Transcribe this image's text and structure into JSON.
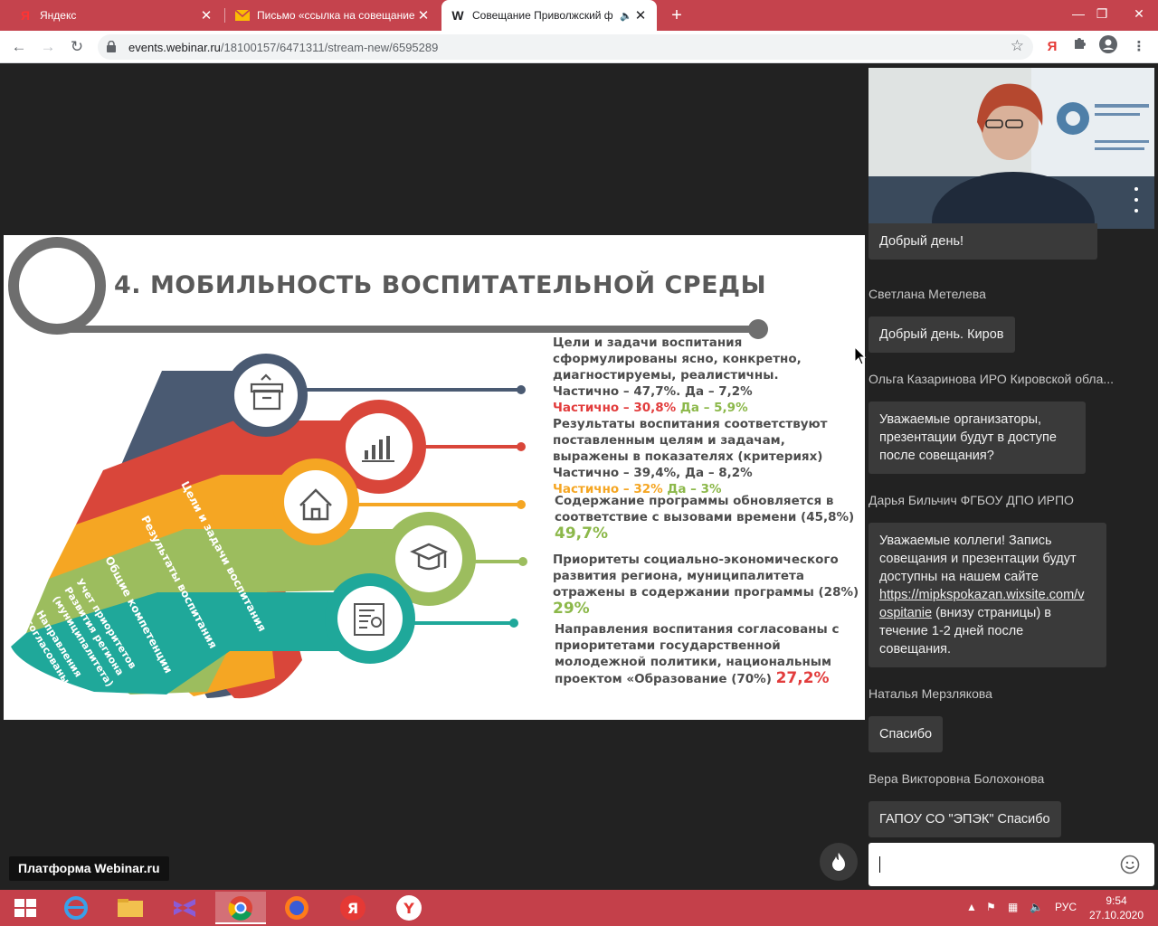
{
  "browser": {
    "tabs": [
      {
        "favicon": "Я",
        "title": "Яндекс"
      },
      {
        "favicon": "envelope",
        "title": "Письмо «ссылка на совещание"
      },
      {
        "favicon": "W",
        "title": "Совещание Приволжский ф"
      }
    ],
    "url_host": "events.webinar.ru",
    "url_path": "/18100157/6471311/stream-new/6595289",
    "yandex_ext": "Я"
  },
  "slide": {
    "title": "4. МОБИЛЬНОСТЬ ВОСПИТАТЕЛЬНОЙ СРЕДЫ",
    "ribbons": [
      "Цели и задачи воспитания",
      "Результаты воспитания",
      "Общие компетенции",
      "Учет приоритетов",
      "Развития региона",
      "(муниципалитета)",
      "Направления",
      "согласованы"
    ],
    "blocks": [
      {
        "lines": [
          "Цели и задачи воспитания",
          "сформулированы ясно, конкретно,",
          "диагностируемы, реалистичны.",
          "Частично – 47,7%. Да – 7,2%"
        ],
        "colored_a": "Частично – 30,8%",
        "colored_b": "Да – 5,9%"
      },
      {
        "lines": [
          "Результаты воспитания соответствуют",
          "поставленным целям и задачам,",
          "выражены в показателях (критериях)",
          "Частично – 39,4%, Да – 8,2%"
        ],
        "colored_a": "Частично – 32%",
        "colored_b": "Да – 3%"
      },
      {
        "lines": [
          "Содержание программы обновляется в",
          "соответствие с вызовами времени (45,8%)"
        ],
        "big": "49,7%"
      },
      {
        "lines": [
          "Приоритеты социально-экономического",
          "развития региона, муниципалитета",
          "отражены в содержании программы (28%)"
        ],
        "big": "29%"
      },
      {
        "lines": [
          "Направления воспитания согласованы с",
          "приоритетами государственной",
          "молодежной политики, национальным"
        ],
        "last_line": "проектом «Образование (70%)",
        "big": "27,2%"
      }
    ]
  },
  "chat": {
    "messages": [
      {
        "author": "",
        "text": "Добрый день!"
      },
      {
        "author": "Светлана Метелева",
        "text": "Добрый день. Киров"
      },
      {
        "author": "Ольга Казаринова ИРО Кировской обла...",
        "text_lines": [
          "Уважаемые организаторы,",
          "презентации будут в доступе",
          "после совещания?"
        ]
      },
      {
        "author": "Дарья Бильчич ФГБОУ ДПО ИРПО",
        "text_lines": [
          "Уважаемые коллеги! Запись",
          "совещания и презентации будут",
          "доступны на нашем сайте"
        ],
        "link_1": "https://mipkspokazan.wixsite.com/v",
        "link_2": "ospitanie",
        "after_link": " (внизу страницы) в",
        "tail_lines": [
          "течение 1-2 дней после",
          "совещания."
        ]
      },
      {
        "author": "Наталья Мерзлякова",
        "text": "Спасибо"
      },
      {
        "author": "Вера Викторовна Болохонова",
        "text": "ГАПОУ СО \"ЭПЭК\" Спасибо"
      }
    ],
    "input_placeholder": ""
  },
  "brand_badge": "Платформа Webinar.ru",
  "taskbar": {
    "lang": "РУС",
    "time": "9:54",
    "date": "27.10.2020"
  },
  "colors": {
    "tabstrip": "#c5434d",
    "taskbar": "#c4404a",
    "ribbon_navy": "#4a5a72",
    "ribbon_red": "#d9463a",
    "ribbon_orange": "#f5a623",
    "ribbon_green": "#9cbd5e",
    "ribbon_teal": "#1fa89a"
  }
}
